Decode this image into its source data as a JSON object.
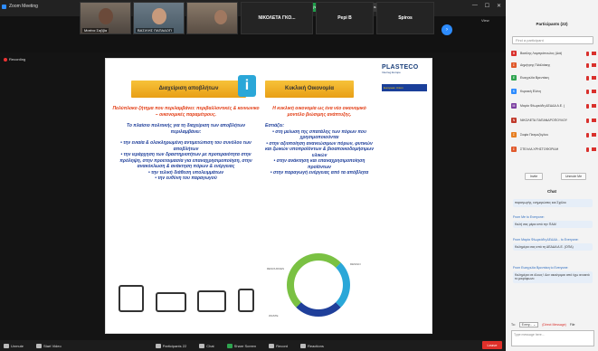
{
  "window": {
    "title": "Zoom Meeting",
    "share_banner": "You are viewing Κάθε Μητσοτάκη's screen",
    "view_options": "View Options ⌄",
    "controls": [
      "—",
      "☐",
      "✕"
    ],
    "side_label": "View"
  },
  "thumbs": [
    {
      "name": "Ματίνα Σαββα"
    },
    {
      "name": "ΒΑΣΙΛΗΣ ΠΑΠΑΔΟΠ"
    },
    {
      "name": ""
    },
    {
      "name": "ΝΙΚΟΛΕΤΑ ΓΚΟ..."
    },
    {
      "name": "Pepi B"
    },
    {
      "name": "Spiros"
    }
  ],
  "next_arrow": "›",
  "recording": "Recording",
  "slide": {
    "left_header": "Διαχείριση αποβλήτων",
    "right_header": "Κυκλική Οικονομία",
    "info_icon": "i",
    "logo": "PLASTECO",
    "logo_sub": "Interreg Europe",
    "eu_flag": "European Union",
    "left_lead": "Πολύπλοκο ζήτημα που περιλαμβάνει: περιβαλλοντικές & κοινωνικο – οικονομικές παραμέτρους.",
    "left_intro": "Το πλαίσιο πολιτικής για τη διαχείριση των αποβλήτων περιλαμβάνει:",
    "left_bullets": [
      "• την ενιαία & ολοκληρωμένη αντιμετώπιση του συνόλου των αποβλήτων",
      "• την ιεράρχηση των δραστηριοτήτων με προτεραιότητα στην πρόληψη, στην προετοιμασία για επαναχρησιμοποίηση, στην ανακύκλωση & ανάκτηση πόρων & ενέργειας",
      "• την τελική διάθεση υπολειμμάτων",
      "• την ευθύνη του παραγωγού"
    ],
    "right_lead": "Η κυκλική οικονομία ως ένα νέο οικονομικό μοντέλο βιώσιμης ανάπτυξης.",
    "right_intro": "Εστιάζει:",
    "right_bullets": [
      "• στη μείωση της σπατάλης των πόρων που χρησιμοποιούνται",
      "• στην αξιοποίηση ανανεώσιμων πόρων, φυτικών και ζωικών υποπροϊόντων & βιοαποικοδομήσιμων υλικών",
      "• στην ανάκτηση και επαναχρησιμοποίηση προϊόντων",
      "• στην παραγωγή ενέργειας από τα απόβλητα"
    ],
    "cycle_labels": [
      "RESOURCES",
      "DESIGN",
      "WASTE"
    ]
  },
  "toolbar": {
    "items": [
      "Unmute",
      "Start Video",
      "Participants 22",
      "Chat",
      "Share Screen",
      "Record",
      "Reactions"
    ],
    "end": "Leave"
  },
  "panel": {
    "title": "Participants (22)",
    "search_placeholder": "Find a participant",
    "participants": [
      {
        "initial": "B",
        "name": "Βασίλης Λαμπρόπουλος (Διά)",
        "color": "#d9302c"
      },
      {
        "initial": "Σ",
        "name": "Δημήτρης Πιλάλιάκης",
        "color": "#e0592b"
      },
      {
        "initial": "E",
        "name": "Ευαγγελία Βρεντάκη",
        "color": "#2ea44f"
      },
      {
        "initial": "K",
        "name": "Κυριακή Ελένη",
        "color": "#2d8cff"
      },
      {
        "initial": "M",
        "name": "Μαρία Φλωρεάδη ΔΕΔΔΑ Α.Ε. (",
        "color": "#7b3fa0"
      },
      {
        "initial": "N",
        "name": "ΝΙΚΟΛΕΤΑ ΠΑΠΑΝΔΡΟΠΟΥΛΟΥ",
        "color": "#c0392b"
      },
      {
        "initial": "Σ",
        "name": "Σοφία Πεσμαζόγλου",
        "color": "#e67e22"
      },
      {
        "initial": "Σ",
        "name": "ΣΤΕΛΛΑ ΧΡΗΣΤΟΦΟΡΙΔΗ",
        "color": "#e0592b"
      }
    ],
    "invite": "Invite",
    "unmute_me": "Unmute Me",
    "chat_title": "Chat",
    "messages": [
      {
        "from": "",
        "text": "παραγωγής, ενημερώσεις και Σχόλιο"
      },
      {
        "from": "From Me to Everyone:",
        "text": "Καλή σας μέρα από την ΠΑΑ!"
      },
      {
        "from": "From Μαρία Φλωρεάδη ΔΕΔΔΑ... to Everyone:",
        "text": "Καλημέρα σας από τη ΔΕΔΔΑ Α.Ε. (ΟΠΑ)"
      },
      {
        "from": "From Ευαγγελία Βρεντάκη to Everyone:",
        "text": "Καλημέρα σε όλους ! Δεν ακούγομαι από έχω ανοικτό το μικρόφωνο"
      }
    ],
    "to_label": "To:",
    "to_value": "Every... ⌄",
    "private_label": "(Direct Message)",
    "file_label": "File",
    "input_placeholder": "Type message here..."
  }
}
